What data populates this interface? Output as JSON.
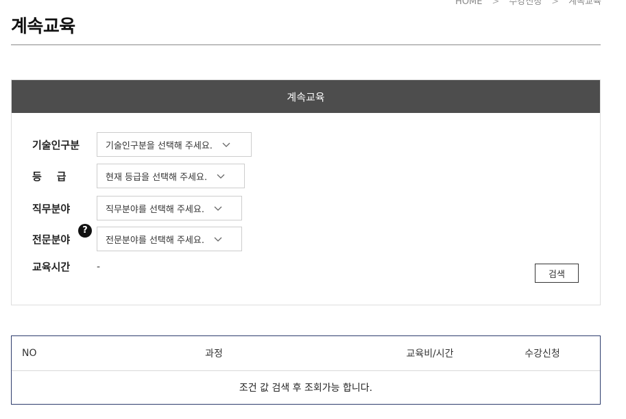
{
  "breadcrumb": {
    "home": "HOME",
    "section": "수강신청",
    "current": "계속교육"
  },
  "page_title": "계속교육",
  "panel": {
    "header": "계속교육"
  },
  "filters": {
    "category": {
      "label": "기술인구분",
      "placeholder": "기술인구분을 선택해 주세요."
    },
    "grade": {
      "label": "등급",
      "placeholder": "현재 등급을 선택해 주세요."
    },
    "job_field": {
      "label": "직무분야",
      "placeholder": "직무분야를 선택해 주세요."
    },
    "specialty_field": {
      "label": "전문분야",
      "placeholder": "전문분야를 선택해 주세요.",
      "help_symbol": "?"
    },
    "edu_time": {
      "label": "교육시간",
      "value": "-"
    }
  },
  "search_button": "검색",
  "table": {
    "headers": {
      "no": "NO",
      "course": "과정",
      "fee_time": "교육비/시간",
      "apply": "수강신청"
    },
    "empty_message": "조건 값 검색 후 조회가능 합니다."
  },
  "colors": {
    "panel_header_bg": "#4d4d4d",
    "table_border": "#2b3a6b"
  },
  "icons": {
    "dropdown": "chevron-down-icon",
    "help": "question-circle-icon"
  }
}
